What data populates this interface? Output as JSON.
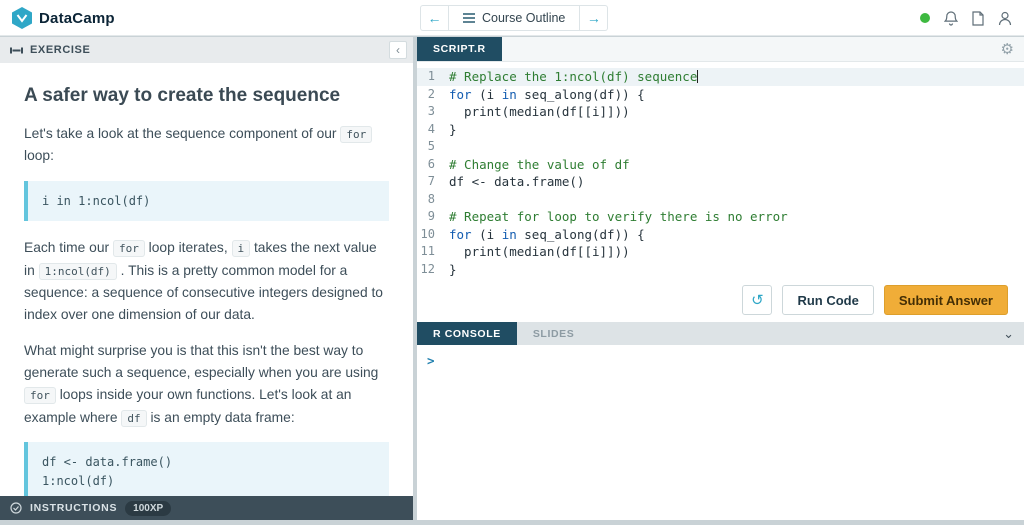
{
  "colors": {
    "brand_teal": "#2fa7c7",
    "dark_slate": "#3d4e59",
    "tab_navy": "#204d63",
    "submit_orange": "#f0ad38",
    "comment_green": "#2e7d32",
    "keyword_blue": "#135cb0"
  },
  "icons": {
    "back": "←",
    "forward": "→",
    "reset": "↺",
    "gear": "⚙",
    "collapse": "‹",
    "chevron_down": "⌄"
  },
  "topbar": {
    "brand": "DataCamp",
    "course_outline_label": "Course Outline"
  },
  "exercise": {
    "header": "EXERCISE",
    "title": "A safer way to create the sequence",
    "p1": [
      "Let's take a look at the sequence component of our ",
      "for",
      " loop:"
    ],
    "code_block_1": "i in 1:ncol(df)",
    "p2": [
      "Each time our ",
      "for",
      " loop iterates, ",
      "i",
      " takes the next value in ",
      "1:ncol(df)",
      " . This is a pretty common model for a sequence: a sequence of consecutive integers designed to index over one dimension of our data."
    ],
    "p3": [
      "What might surprise you is that this isn't the best way to generate such a sequence, especially when you are using ",
      "for",
      " loops inside your own functions. Let's look at an example where ",
      "df",
      " is an empty data frame:"
    ],
    "code_block_2": [
      "df <- data.frame()",
      "1:ncol(df)"
    ]
  },
  "instructions_bar": {
    "label": "INSTRUCTIONS",
    "xp": "100XP"
  },
  "editor": {
    "tab": "SCRIPT.R",
    "lines": [
      {
        "n": 1,
        "active": true,
        "cursor": true,
        "tokens": [
          [
            "comment",
            "# Replace the 1:ncol(df) sequence"
          ]
        ]
      },
      {
        "n": 2,
        "tokens": [
          [
            "keyword",
            "for"
          ],
          [
            "plain",
            " (i "
          ],
          [
            "keyword",
            "in"
          ],
          [
            "plain",
            " seq_along(df)) {"
          ]
        ]
      },
      {
        "n": 3,
        "tokens": [
          [
            "plain",
            "  print(median(df[[i]]))"
          ]
        ]
      },
      {
        "n": 4,
        "tokens": [
          [
            "plain",
            "}"
          ]
        ]
      },
      {
        "n": 5,
        "tokens": []
      },
      {
        "n": 6,
        "tokens": [
          [
            "comment",
            "# Change the value of df"
          ]
        ]
      },
      {
        "n": 7,
        "tokens": [
          [
            "plain",
            "df <- data.frame()"
          ]
        ]
      },
      {
        "n": 8,
        "tokens": []
      },
      {
        "n": 9,
        "tokens": [
          [
            "comment",
            "# Repeat for loop to verify there is no error"
          ]
        ]
      },
      {
        "n": 10,
        "tokens": [
          [
            "keyword",
            "for"
          ],
          [
            "plain",
            " (i "
          ],
          [
            "keyword",
            "in"
          ],
          [
            "plain",
            " seq_along(df)) {"
          ]
        ]
      },
      {
        "n": 11,
        "tokens": [
          [
            "plain",
            "  print(median(df[[i]]))"
          ]
        ]
      },
      {
        "n": 12,
        "tokens": [
          [
            "plain",
            "}"
          ]
        ]
      }
    ]
  },
  "actions": {
    "run": "Run Code",
    "submit": "Submit Answer"
  },
  "console": {
    "tabs": [
      "R CONSOLE",
      "SLIDES"
    ],
    "prompt": ">"
  }
}
